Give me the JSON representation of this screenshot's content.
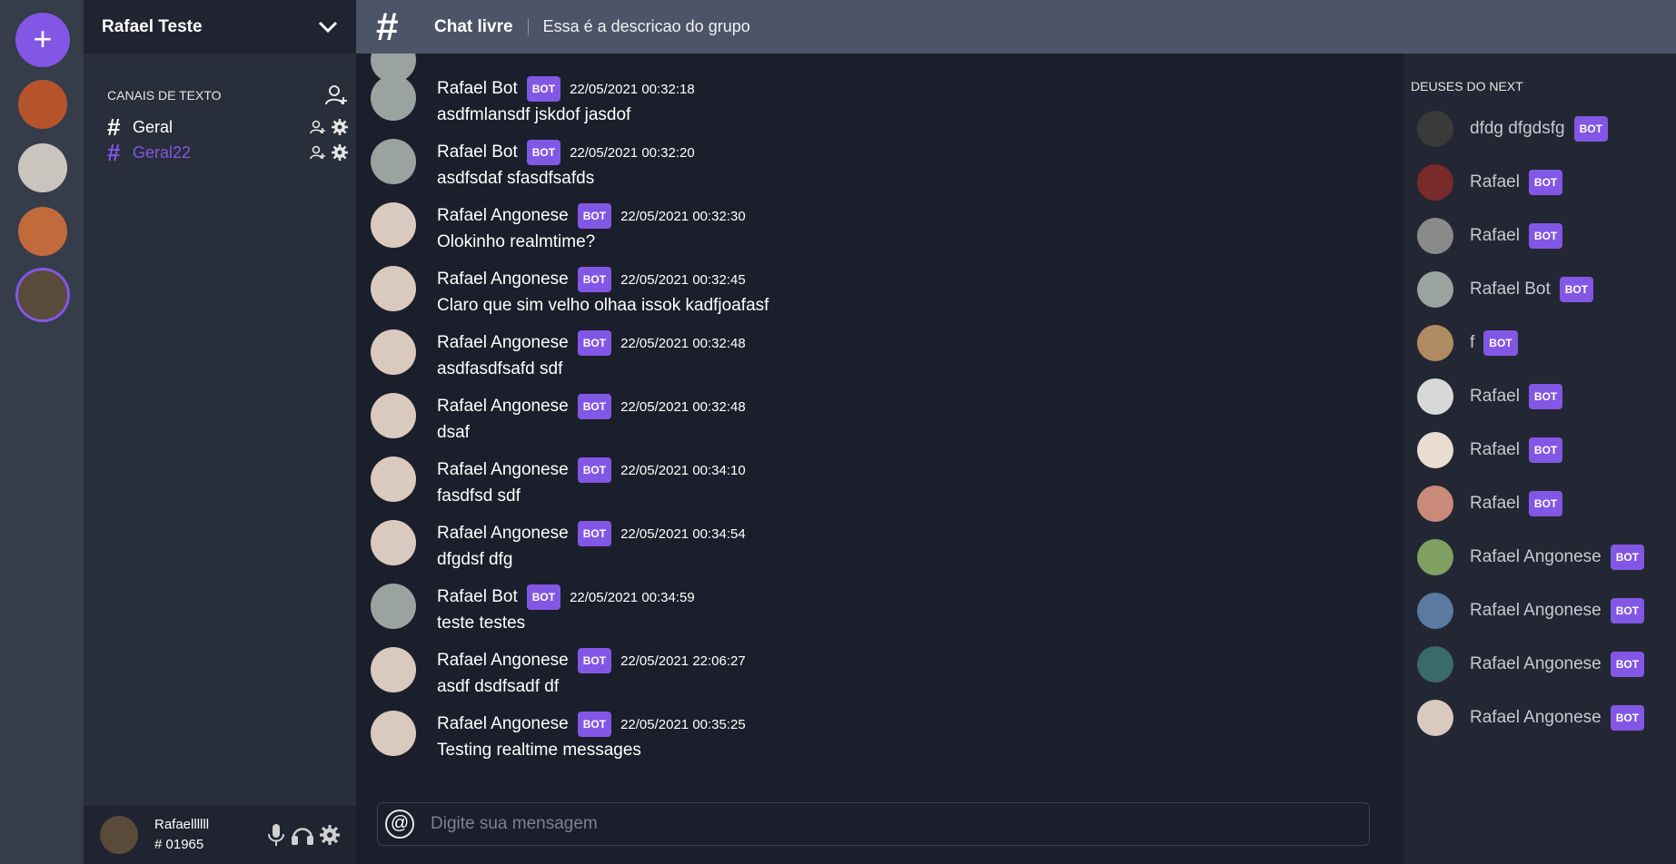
{
  "server_rail": {
    "add_label": "+",
    "servers": [
      {
        "color": "#b5532d"
      },
      {
        "color": "#c9c4bd"
      },
      {
        "color": "#c26a3c"
      },
      {
        "color": "#5a4a3a",
        "active": true
      }
    ]
  },
  "sidebar": {
    "server_name": "Rafael Teste",
    "category_label": "CANAIS DE TEXTO",
    "channels": [
      {
        "name": "Geral",
        "active": false
      },
      {
        "name": "Geral22",
        "active": true
      }
    ],
    "user": {
      "name": "Rafaellllll",
      "tag": "# 01965"
    }
  },
  "header": {
    "hash": "#",
    "title": "Chat livre",
    "description": "Essa é a descricao do grupo"
  },
  "messages": [
    {
      "author": "Rafael Bot",
      "badge": "BOT",
      "time": "22/05/2021 00:32:18",
      "text": "asdfmlansdf jskdof jasdof",
      "avatar_color": "#9aa3a0"
    },
    {
      "author": "Rafael Bot",
      "badge": "BOT",
      "time": "22/05/2021 00:32:20",
      "text": "asdfsdaf sfasdfsafds",
      "avatar_color": "#9aa3a0"
    },
    {
      "author": "Rafael Angonese",
      "badge": "BOT",
      "time": "22/05/2021 00:32:30",
      "text": "Olokinho realmtime?",
      "avatar_color": "#d9c9bf"
    },
    {
      "author": "Rafael Angonese",
      "badge": "BOT",
      "time": "22/05/2021 00:32:45",
      "text": "Claro que sim velho olhaa issok kadfjoafasf",
      "avatar_color": "#d9c9bf"
    },
    {
      "author": "Rafael Angonese",
      "badge": "BOT",
      "time": "22/05/2021 00:32:48",
      "text": "asdfasdfsafd sdf",
      "avatar_color": "#d9c9bf"
    },
    {
      "author": "Rafael Angonese",
      "badge": "BOT",
      "time": "22/05/2021 00:32:48",
      "text": "dsaf",
      "avatar_color": "#d9c9bf"
    },
    {
      "author": "Rafael Angonese",
      "badge": "BOT",
      "time": "22/05/2021 00:34:10",
      "text": "fasdfsd sdf",
      "avatar_color": "#d9c9bf"
    },
    {
      "author": "Rafael Angonese",
      "badge": "BOT",
      "time": "22/05/2021 00:34:54",
      "text": "dfgdsf dfg",
      "avatar_color": "#d9c9bf"
    },
    {
      "author": "Rafael Bot",
      "badge": "BOT",
      "time": "22/05/2021 00:34:59",
      "text": "teste testes",
      "avatar_color": "#9aa3a0"
    },
    {
      "author": "Rafael Angonese",
      "badge": "BOT",
      "time": "22/05/2021 22:06:27",
      "text": "asdf dsdfsadf df",
      "avatar_color": "#d9c9bf"
    },
    {
      "author": "Rafael Angonese",
      "badge": "BOT",
      "time": "22/05/2021 00:35:25",
      "text": "Testing realtime messages",
      "avatar_color": "#d9c9bf"
    }
  ],
  "composer": {
    "placeholder": "Digite sua mensagem",
    "at_icon": "@"
  },
  "members": {
    "title": "DEUSES DO NEXT",
    "list": [
      {
        "name": "dfdg dfgdsfg",
        "badge": "BOT",
        "avatar_color": "#3a3a3a"
      },
      {
        "name": "Rafael",
        "badge": "BOT",
        "avatar_color": "#7a2a2a"
      },
      {
        "name": "Rafael",
        "badge": "BOT",
        "avatar_color": "#8a8a8a"
      },
      {
        "name": "Rafael Bot",
        "badge": "BOT",
        "avatar_color": "#9aa3a0"
      },
      {
        "name": "f",
        "badge": "BOT",
        "avatar_color": "#b08a60"
      },
      {
        "name": "Rafael",
        "badge": "BOT",
        "avatar_color": "#d8d8d8"
      },
      {
        "name": "Rafael",
        "badge": "BOT",
        "avatar_color": "#e9dcd0"
      },
      {
        "name": "Rafael",
        "badge": "BOT",
        "avatar_color": "#c98a7a"
      },
      {
        "name": "Rafael Angonese",
        "badge": "BOT",
        "avatar_color": "#7fa060"
      },
      {
        "name": "Rafael Angonese",
        "badge": "BOT",
        "avatar_color": "#5a7aa0"
      },
      {
        "name": "Rafael Angonese",
        "badge": "BOT",
        "avatar_color": "#3a6a6a"
      },
      {
        "name": "Rafael Angonese",
        "badge": "BOT",
        "avatar_color": "#d9c9bf"
      }
    ]
  },
  "colors": {
    "accent": "#8257e5"
  }
}
